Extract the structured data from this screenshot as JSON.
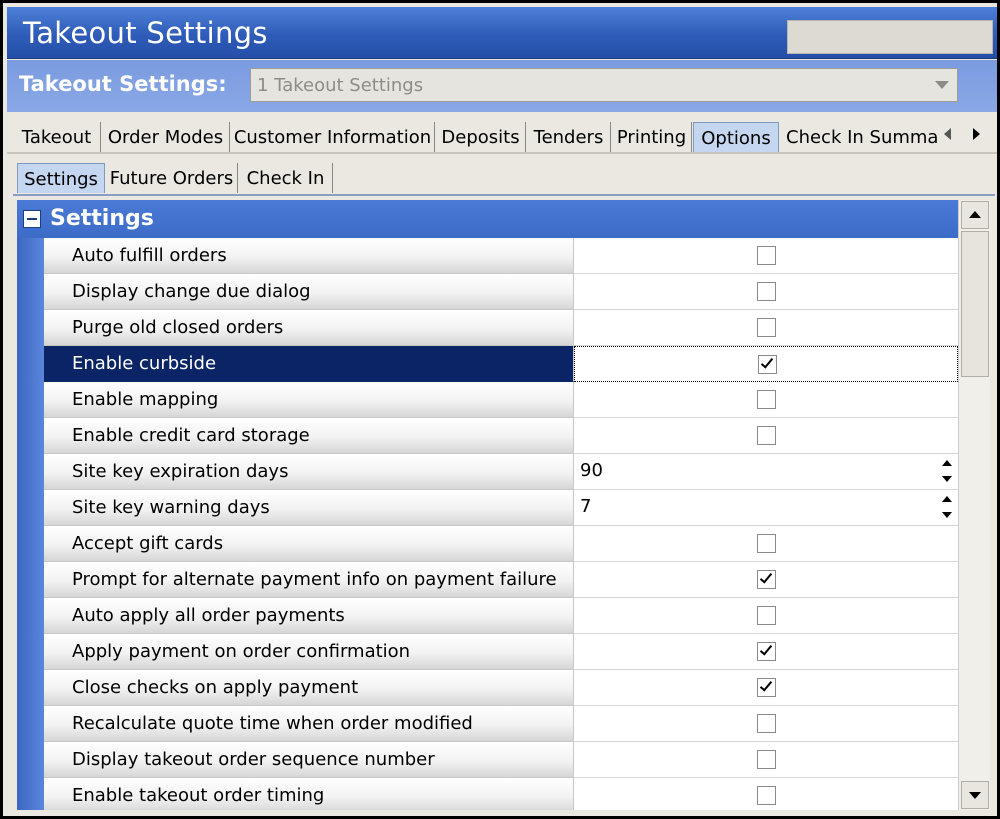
{
  "window": {
    "title": "Takeout Settings"
  },
  "selector": {
    "label": "Takeout Settings:",
    "value": "1 Takeout Settings"
  },
  "tabs": [
    {
      "label": "Takeout"
    },
    {
      "label": "Order Modes"
    },
    {
      "label": "Customer Information"
    },
    {
      "label": "Deposits"
    },
    {
      "label": "Tenders"
    },
    {
      "label": "Printing"
    },
    {
      "label": "Options"
    },
    {
      "label": "Check In Summar"
    }
  ],
  "active_tab": "Options",
  "sub_tabs": [
    {
      "label": "Settings"
    },
    {
      "label": "Future Orders"
    },
    {
      "label": "Check In"
    }
  ],
  "active_sub_tab": "Settings",
  "grid": {
    "title": "Settings",
    "rows": [
      {
        "label": "Auto fulfill orders",
        "type": "checkbox",
        "checked": false
      },
      {
        "label": "Display change due dialog",
        "type": "checkbox",
        "checked": false
      },
      {
        "label": "Purge old closed orders",
        "type": "checkbox",
        "checked": false
      },
      {
        "label": "Enable curbside",
        "type": "checkbox",
        "checked": true,
        "selected": true
      },
      {
        "label": "Enable mapping",
        "type": "checkbox",
        "checked": false
      },
      {
        "label": "Enable credit card storage",
        "type": "checkbox",
        "checked": false
      },
      {
        "label": "Site key expiration days",
        "type": "number",
        "value": "90"
      },
      {
        "label": "Site key warning days",
        "type": "number",
        "value": "7"
      },
      {
        "label": "Accept gift cards",
        "type": "checkbox",
        "checked": false
      },
      {
        "label": "Prompt for alternate payment info on payment failure",
        "type": "checkbox",
        "checked": true
      },
      {
        "label": "Auto apply all order payments",
        "type": "checkbox",
        "checked": false
      },
      {
        "label": "Apply payment on order confirmation",
        "type": "checkbox",
        "checked": true
      },
      {
        "label": "Close checks on apply payment",
        "type": "checkbox",
        "checked": true
      },
      {
        "label": "Recalculate quote time when order modified",
        "type": "checkbox",
        "checked": false
      },
      {
        "label": "Display takeout order sequence number",
        "type": "checkbox",
        "checked": false
      },
      {
        "label": "Enable takeout order timing",
        "type": "checkbox",
        "checked": false
      }
    ]
  },
  "icons": {
    "dropdown": "chevron-down-icon",
    "tab_left": "arrow-left-icon",
    "tab_right": "arrow-right-icon",
    "collapse": "minus-box-icon",
    "scroll_up": "arrow-up-icon",
    "scroll_down": "arrow-down-icon",
    "check": "check-icon",
    "spin": "spinner-arrows-icon"
  }
}
